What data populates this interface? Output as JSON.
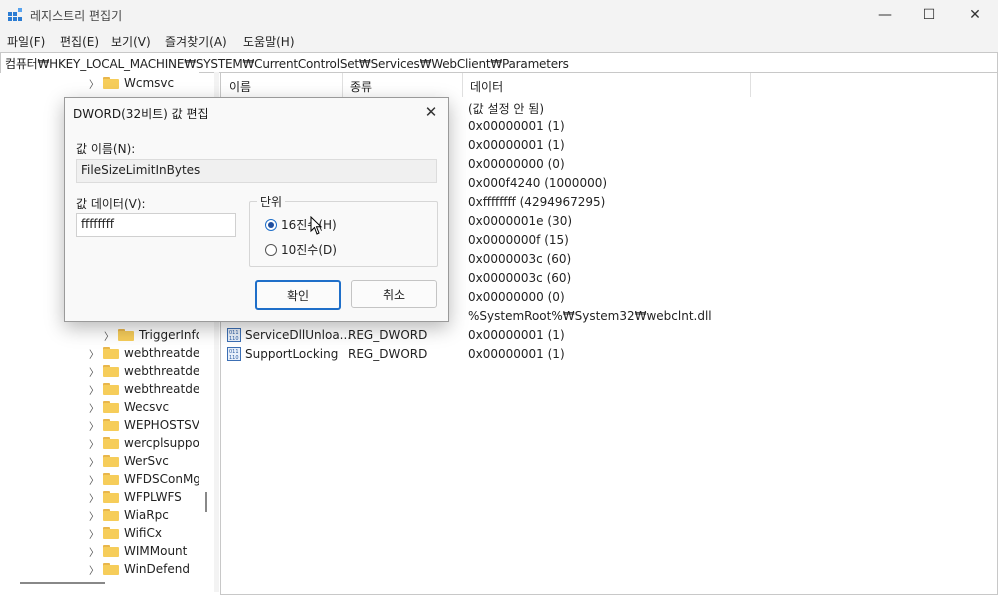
{
  "window": {
    "title": "레지스트리 편집기",
    "minimize": "—",
    "maximize": "☐",
    "close": "✕"
  },
  "menu": [
    "파일(F)",
    "편집(E)",
    "보기(V)",
    "즐겨찾기(A)",
    "도움말(H)"
  ],
  "address": "컴퓨터₩HKEY_LOCAL_MACHINE₩SYSTEM₩CurrentControlSet₩Services₩WebClient₩Parameters",
  "tree": {
    "items": [
      {
        "label": "Wcmsvc",
        "expander": true
      },
      {
        "label": "TriggerInfo",
        "expander": true
      },
      {
        "label": "webthreatdefs",
        "expander": true
      },
      {
        "label": "webthreatdefu",
        "expander": true
      },
      {
        "label": "webthreatdefu",
        "expander": true
      },
      {
        "label": "Wecsvc",
        "expander": true
      },
      {
        "label": "WEPHOSTSVC",
        "expander": true
      },
      {
        "label": "wercplsupport",
        "expander": true
      },
      {
        "label": "WerSvc",
        "expander": true
      },
      {
        "label": "WFDSConMgr",
        "expander": true
      },
      {
        "label": "WFPLWFS",
        "expander": true
      },
      {
        "label": "WiaRpc",
        "expander": true
      },
      {
        "label": "WifiCx",
        "expander": true
      },
      {
        "label": "WIMMount",
        "expander": true
      },
      {
        "label": "WinDefend",
        "expander": true
      }
    ]
  },
  "list": {
    "columns": [
      "이름",
      "종류",
      "데이터"
    ],
    "rows": [
      {
        "name": "",
        "type": "",
        "data": "(값 설정 안 됨)"
      },
      {
        "name": "",
        "type": "",
        "data": "0x00000001 (1)"
      },
      {
        "name": "",
        "type": "",
        "data": "0x00000001 (1)"
      },
      {
        "name": "",
        "type": "",
        "data": "0x00000000 (0)"
      },
      {
        "name": "",
        "type": "",
        "data": "0x000f4240 (1000000)"
      },
      {
        "name": "",
        "type": "",
        "data": "0xffffffff (4294967295)"
      },
      {
        "name": "",
        "type": "",
        "data": "0x0000001e (30)"
      },
      {
        "name": "",
        "type": "",
        "data": "0x0000000f (15)"
      },
      {
        "name": "",
        "type": "",
        "data": "0x0000003c (60)"
      },
      {
        "name": "",
        "type": "",
        "data": "0x0000003c (60)"
      },
      {
        "name": "",
        "type": "",
        "data": "0x00000000 (0)"
      },
      {
        "name": "",
        "type": "",
        "data": "%SystemRoot%₩System32₩webclnt.dll"
      },
      {
        "name": "ServiceDllUnloa...",
        "type": "REG_DWORD",
        "data": "0x00000001 (1)"
      },
      {
        "name": "SupportLocking",
        "type": "REG_DWORD",
        "data": "0x00000001 (1)"
      }
    ]
  },
  "dialog": {
    "title": "DWORD(32비트) 값 편집",
    "name_label": "값 이름(N):",
    "name_value": "FileSizeLimitInBytes",
    "data_label": "값 데이터(V):",
    "data_value": "ffffffff",
    "base_group": "단위",
    "radio_hex": "16진수(H)",
    "radio_dec": "10진수(D)",
    "selected_base": "hex",
    "ok": "확인",
    "cancel": "취소"
  },
  "colors": {
    "accent": "#1f6fc9",
    "folder": "#f6cd5a",
    "titlebar": "#f3f3f3",
    "dialog_bg": "#f9f9f9"
  }
}
